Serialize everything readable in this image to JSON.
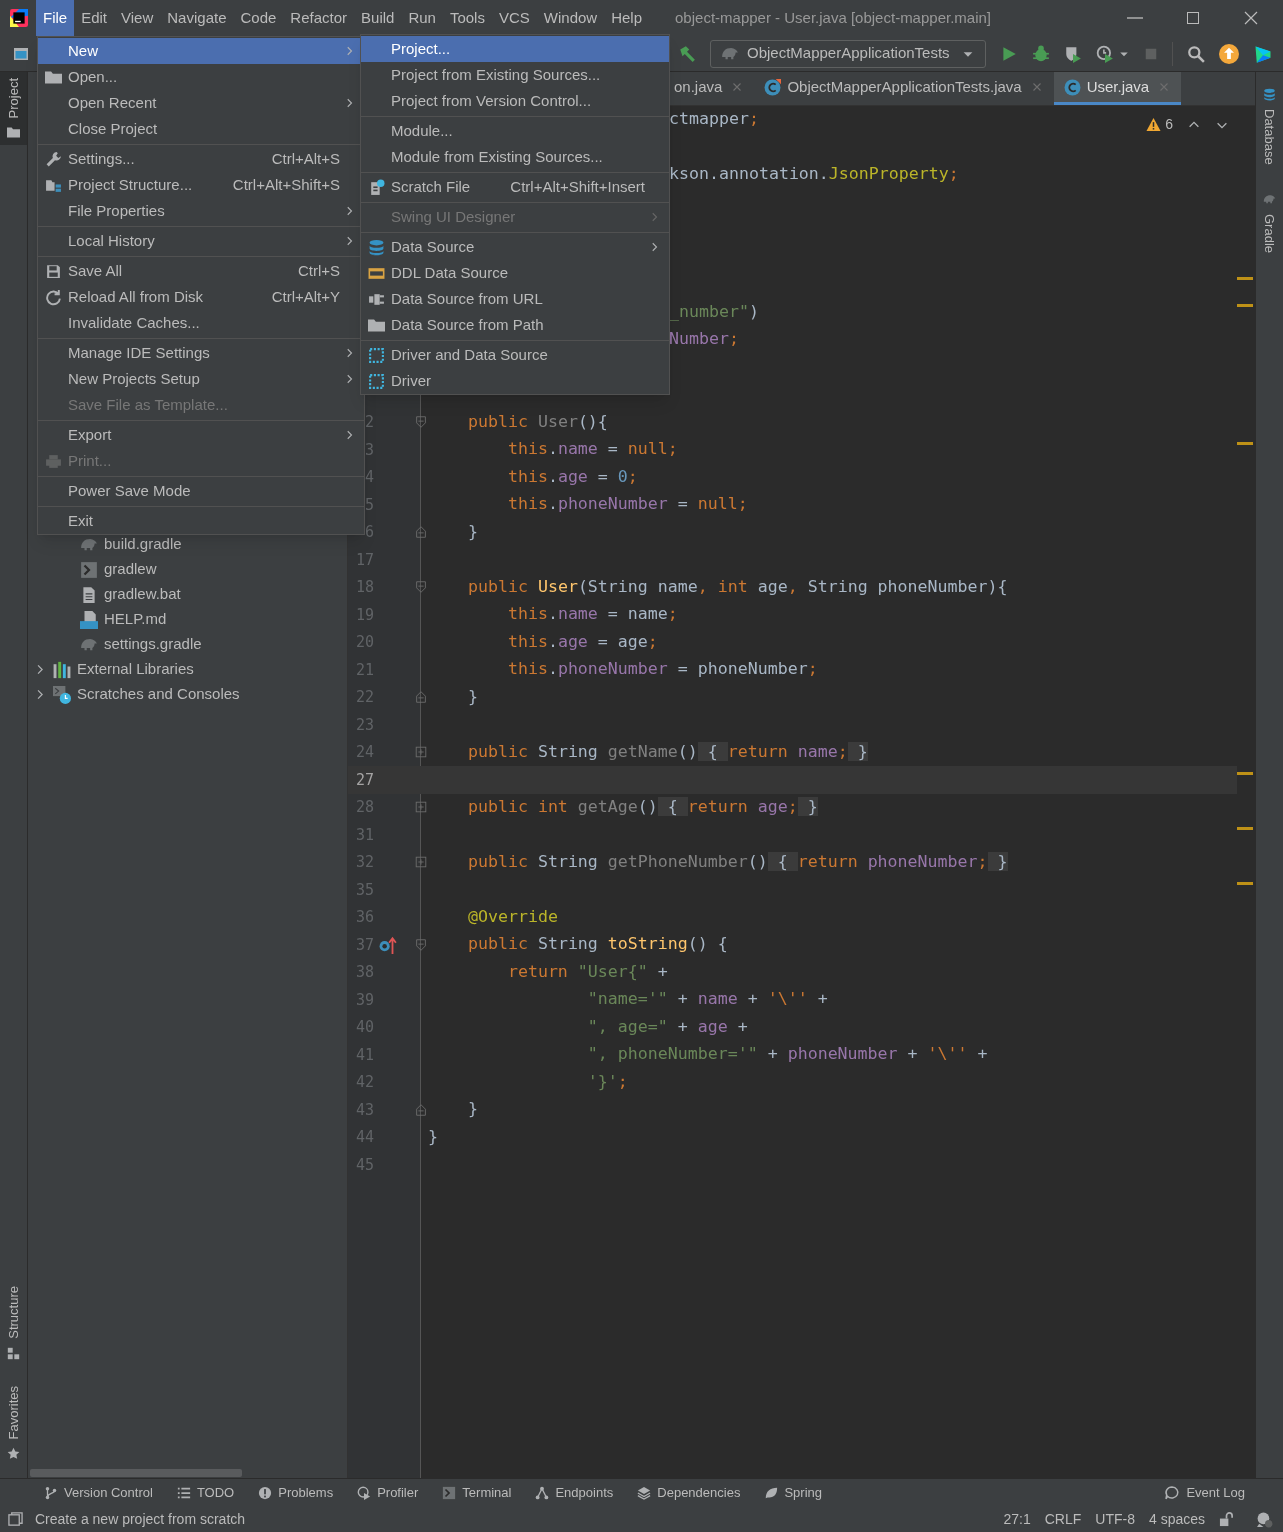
{
  "window": {
    "title": "object-mapper - User.java [object-mapper.main]"
  },
  "menubar": [
    {
      "label": "File",
      "selected": true
    },
    {
      "label": "Edit",
      "selected": false
    },
    {
      "label": "View",
      "selected": false
    },
    {
      "label": "Navigate",
      "selected": false
    },
    {
      "label": "Code",
      "selected": false
    },
    {
      "label": "Refactor",
      "selected": false
    },
    {
      "label": "Build",
      "selected": false
    },
    {
      "label": "Run",
      "selected": false
    },
    {
      "label": "Tools",
      "selected": false
    },
    {
      "label": "VCS",
      "selected": false
    },
    {
      "label": "Window",
      "selected": false
    },
    {
      "label": "Help",
      "selected": false
    }
  ],
  "file_menu": {
    "groups": [
      [
        {
          "label": "New",
          "submenu": true,
          "selected": true,
          "disabled": false
        },
        {
          "label": "Open...",
          "submenu": false,
          "selected": false,
          "disabled": false
        },
        {
          "label": "Open Recent",
          "submenu": true,
          "selected": false,
          "disabled": false
        },
        {
          "label": "Close Project",
          "submenu": false,
          "selected": false,
          "disabled": false
        }
      ],
      [
        {
          "label": "Settings...",
          "shortcut": "Ctrl+Alt+S",
          "submenu": false,
          "selected": false,
          "disabled": false
        },
        {
          "label": "Project Structure...",
          "shortcut": "Ctrl+Alt+Shift+S",
          "submenu": false,
          "selected": false,
          "disabled": false
        },
        {
          "label": "File Properties",
          "submenu": true,
          "selected": false,
          "disabled": false
        }
      ],
      [
        {
          "label": "Local History",
          "submenu": true,
          "selected": false,
          "disabled": false
        }
      ],
      [
        {
          "label": "Save All",
          "shortcut": "Ctrl+S",
          "submenu": false,
          "selected": false,
          "disabled": false
        },
        {
          "label": "Reload All from Disk",
          "shortcut": "Ctrl+Alt+Y",
          "submenu": false,
          "selected": false,
          "disabled": false
        },
        {
          "label": "Invalidate Caches...",
          "submenu": false,
          "selected": false,
          "disabled": false
        }
      ],
      [
        {
          "label": "Manage IDE Settings",
          "submenu": true,
          "selected": false,
          "disabled": false
        },
        {
          "label": "New Projects Setup",
          "submenu": true,
          "selected": false,
          "disabled": false
        },
        {
          "label": "Save File as Template...",
          "submenu": false,
          "selected": false,
          "disabled": true
        }
      ],
      [
        {
          "label": "Export",
          "submenu": true,
          "selected": false,
          "disabled": false
        },
        {
          "label": "Print...",
          "submenu": false,
          "selected": false,
          "disabled": true
        }
      ],
      [
        {
          "label": "Power Save Mode",
          "submenu": false,
          "selected": false,
          "disabled": false
        }
      ],
      [
        {
          "label": "Exit",
          "submenu": false,
          "selected": false,
          "disabled": false
        }
      ]
    ]
  },
  "new_submenu": {
    "groups": [
      [
        {
          "label": "Project...",
          "submenu": false,
          "selected": true,
          "disabled": false
        },
        {
          "label": "Project from Existing Sources...",
          "submenu": false,
          "selected": false,
          "disabled": false
        },
        {
          "label": "Project from Version Control...",
          "submenu": false,
          "selected": false,
          "disabled": false
        }
      ],
      [
        {
          "label": "Module...",
          "submenu": false,
          "selected": false,
          "disabled": false
        },
        {
          "label": "Module from Existing Sources...",
          "submenu": false,
          "selected": false,
          "disabled": false
        }
      ],
      [
        {
          "label": "Scratch File",
          "shortcut": "Ctrl+Alt+Shift+Insert",
          "submenu": false,
          "selected": false,
          "disabled": false
        }
      ],
      [
        {
          "label": "Swing UI Designer",
          "submenu": true,
          "selected": false,
          "disabled": true
        }
      ],
      [
        {
          "label": "Data Source",
          "submenu": true,
          "selected": false,
          "disabled": false
        },
        {
          "label": "DDL Data Source",
          "submenu": false,
          "selected": false,
          "disabled": false
        },
        {
          "label": "Data Source from URL",
          "submenu": false,
          "selected": false,
          "disabled": false
        },
        {
          "label": "Data Source from Path",
          "submenu": false,
          "selected": false,
          "disabled": false
        }
      ],
      [
        {
          "label": "Driver and Data Source",
          "submenu": false,
          "selected": false,
          "disabled": false
        },
        {
          "label": "Driver",
          "submenu": false,
          "selected": false,
          "disabled": false
        }
      ]
    ]
  },
  "toolbar": {
    "run_configuration": "ObjectMapperApplicationTests"
  },
  "tabs": [
    {
      "label": "on.java",
      "selected": false
    },
    {
      "label": "ObjectMapperApplicationTests.java",
      "selected": false
    },
    {
      "label": "User.java",
      "selected": true
    }
  ],
  "left_stripe": {
    "top": [
      {
        "label": "Project",
        "selected": true
      }
    ],
    "bottom": [
      {
        "label": "Structure",
        "selected": false
      },
      {
        "label": "Favorites",
        "selected": false
      }
    ]
  },
  "right_stripe": [
    {
      "label": "Database",
      "selected": false
    },
    {
      "label": "Gradle",
      "selected": false
    }
  ],
  "project_tree": {
    "files": [
      {
        "label": "build.gradle"
      },
      {
        "label": "gradlew"
      },
      {
        "label": "gradlew.bat"
      },
      {
        "label": "HELP.md"
      },
      {
        "label": "settings.gradle"
      }
    ],
    "nodes": [
      {
        "label": "External Libraries",
        "expanded": false
      },
      {
        "label": "Scratches and Consoles",
        "expanded": false
      }
    ]
  },
  "editor": {
    "warnings": "6",
    "lines": [
      {
        "kind": "clipped",
        "tokens": [
          {
            "kind": "plain",
            "text": "ctmapper"
          },
          {
            "kind": "kw",
            "text": ";"
          }
        ]
      },
      {
        "kind": "blank"
      },
      {
        "kind": "clipped",
        "tokens": [
          {
            "kind": "plain",
            "text": "kson.annotation."
          },
          {
            "kind": "ann",
            "text": "JsonProperty"
          },
          {
            "kind": "kw",
            "text": ";"
          }
        ]
      },
      {
        "kind": "blank"
      },
      {
        "kind": "blank"
      },
      {
        "kind": "blank"
      },
      {
        "kind": "blank"
      },
      {
        "kind": "clipped",
        "tokens": [
          {
            "kind": "str",
            "text": "_number\""
          },
          {
            "kind": "plain",
            "text": ")"
          }
        ]
      },
      {
        "kind": "clipped",
        "tokens": [
          {
            "kind": "field",
            "text": "Number"
          },
          {
            "kind": "kw",
            "text": ";"
          }
        ]
      },
      {
        "kind": "blank"
      },
      {
        "kind": "blank"
      },
      {
        "kind": "code",
        "number": "2",
        "gutter": [
          {
            "kind": "fold_open"
          }
        ],
        "tokens": [
          {
            "kind": "kw",
            "text": "    public "
          },
          {
            "kind": "muted",
            "text": "User"
          },
          {
            "kind": "plain",
            "text": "(){"
          }
        ]
      },
      {
        "kind": "code",
        "number": "3",
        "tokens": [
          {
            "kind": "kw",
            "text": "        this"
          },
          {
            "kind": "plain",
            "text": "."
          },
          {
            "kind": "field",
            "text": "name"
          },
          {
            "kind": "plain",
            "text": " = "
          },
          {
            "kind": "kw",
            "text": "null;"
          }
        ]
      },
      {
        "kind": "code",
        "number": "4",
        "tokens": [
          {
            "kind": "kw",
            "text": "        this"
          },
          {
            "kind": "plain",
            "text": "."
          },
          {
            "kind": "field",
            "text": "age"
          },
          {
            "kind": "plain",
            "text": " = "
          },
          {
            "kind": "num",
            "text": "0"
          },
          {
            "kind": "kw",
            "text": ";"
          }
        ]
      },
      {
        "kind": "code",
        "number": "5",
        "tokens": [
          {
            "kind": "kw",
            "text": "        this"
          },
          {
            "kind": "plain",
            "text": "."
          },
          {
            "kind": "field",
            "text": "phoneNumber"
          },
          {
            "kind": "plain",
            "text": " = "
          },
          {
            "kind": "kw",
            "text": "null;"
          }
        ]
      },
      {
        "kind": "code",
        "number": "6",
        "gutter": [
          {
            "kind": "fold_close"
          }
        ],
        "tokens": [
          {
            "kind": "plain",
            "text": "    }"
          }
        ]
      },
      {
        "number": "17"
      },
      {
        "kind": "code",
        "number": "18",
        "gutter": [
          {
            "kind": "fold_open"
          }
        ],
        "tokens": [
          {
            "kind": "kw",
            "text": "    public "
          },
          {
            "kind": "decl",
            "text": "User"
          },
          {
            "kind": "plain",
            "text": "(String name"
          },
          {
            "kind": "kw",
            "text": ", int "
          },
          {
            "kind": "plain",
            "text": "age"
          },
          {
            "kind": "kw",
            "text": ", "
          },
          {
            "kind": "plain",
            "text": "String phoneNumber){"
          }
        ]
      },
      {
        "kind": "code",
        "number": "19",
        "tokens": [
          {
            "kind": "kw",
            "text": "        this"
          },
          {
            "kind": "plain",
            "text": "."
          },
          {
            "kind": "field",
            "text": "name"
          },
          {
            "kind": "plain",
            "text": " = name"
          },
          {
            "kind": "kw",
            "text": ";"
          }
        ]
      },
      {
        "kind": "code",
        "number": "20",
        "tokens": [
          {
            "kind": "kw",
            "text": "        this"
          },
          {
            "kind": "plain",
            "text": "."
          },
          {
            "kind": "field",
            "text": "age"
          },
          {
            "kind": "plain",
            "text": " = age"
          },
          {
            "kind": "kw",
            "text": ";"
          }
        ]
      },
      {
        "kind": "code",
        "number": "21",
        "tokens": [
          {
            "kind": "kw",
            "text": "        this"
          },
          {
            "kind": "plain",
            "text": "."
          },
          {
            "kind": "field",
            "text": "phoneNumber"
          },
          {
            "kind": "plain",
            "text": " = phoneNumber"
          },
          {
            "kind": "kw",
            "text": ";"
          }
        ]
      },
      {
        "kind": "code",
        "number": "22",
        "gutter": [
          {
            "kind": "fold_close"
          }
        ],
        "tokens": [
          {
            "kind": "plain",
            "text": "    }"
          }
        ]
      },
      {
        "number": "23"
      },
      {
        "kind": "code",
        "number": "24",
        "gutter": [
          {
            "kind": "folded"
          }
        ],
        "tokens": [
          {
            "kind": "kw",
            "text": "    public "
          },
          {
            "kind": "plain",
            "text": "String "
          },
          {
            "kind": "muted",
            "text": "getName"
          },
          {
            "kind": "plain",
            "text": "()"
          },
          {
            "kind": "fold",
            "text": " { "
          },
          {
            "kind": "kw",
            "text": "return "
          },
          {
            "kind": "field",
            "text": "name"
          },
          {
            "kind": "kw",
            "text": ";"
          },
          {
            "kind": "fold",
            "text": " }"
          }
        ]
      },
      {
        "number": "27",
        "current": true
      },
      {
        "kind": "code",
        "number": "28",
        "gutter": [
          {
            "kind": "folded"
          }
        ],
        "tokens": [
          {
            "kind": "kw",
            "text": "    public int "
          },
          {
            "kind": "muted",
            "text": "getAge"
          },
          {
            "kind": "plain",
            "text": "()"
          },
          {
            "kind": "fold",
            "text": " { "
          },
          {
            "kind": "kw",
            "text": "return "
          },
          {
            "kind": "field",
            "text": "age"
          },
          {
            "kind": "kw",
            "text": ";"
          },
          {
            "kind": "fold",
            "text": " }"
          }
        ]
      },
      {
        "number": "31"
      },
      {
        "kind": "code",
        "number": "32",
        "gutter": [
          {
            "kind": "folded"
          }
        ],
        "tokens": [
          {
            "kind": "kw",
            "text": "    public "
          },
          {
            "kind": "plain",
            "text": "String "
          },
          {
            "kind": "muted",
            "text": "getPhoneNumber"
          },
          {
            "kind": "plain",
            "text": "()"
          },
          {
            "kind": "fold",
            "text": " { "
          },
          {
            "kind": "kw",
            "text": "return "
          },
          {
            "kind": "field",
            "text": "phoneNumber"
          },
          {
            "kind": "kw",
            "text": ";"
          },
          {
            "kind": "fold",
            "text": " }"
          }
        ]
      },
      {
        "number": "35"
      },
      {
        "kind": "code",
        "number": "36",
        "tokens": [
          {
            "kind": "ann",
            "text": "    @Override"
          }
        ]
      },
      {
        "kind": "code",
        "number": "37",
        "gutter": [
          {
            "kind": "override"
          },
          {
            "kind": "fold_open"
          }
        ],
        "tokens": [
          {
            "kind": "kw",
            "text": "    public "
          },
          {
            "kind": "plain",
            "text": "String "
          },
          {
            "kind": "decl",
            "text": "toString"
          },
          {
            "kind": "plain",
            "text": "() {"
          }
        ]
      },
      {
        "kind": "code",
        "number": "38",
        "tokens": [
          {
            "kind": "kw",
            "text": "        return "
          },
          {
            "kind": "str",
            "text": "\"User{\""
          },
          {
            "kind": "plain",
            "text": " +"
          }
        ]
      },
      {
        "kind": "code",
        "number": "39",
        "tokens": [
          {
            "kind": "str",
            "text": "                \"name='\""
          },
          {
            "kind": "plain",
            "text": " + "
          },
          {
            "kind": "field",
            "text": "name"
          },
          {
            "kind": "plain",
            "text": " + "
          },
          {
            "kind": "kw",
            "text": "'\\''"
          },
          {
            "kind": "plain",
            "text": " +"
          }
        ]
      },
      {
        "kind": "code",
        "number": "40",
        "tokens": [
          {
            "kind": "str",
            "text": "                \", age=\""
          },
          {
            "kind": "plain",
            "text": " + "
          },
          {
            "kind": "field",
            "text": "age"
          },
          {
            "kind": "plain",
            "text": " +"
          }
        ]
      },
      {
        "kind": "code",
        "number": "41",
        "tokens": [
          {
            "kind": "str",
            "text": "                \", phoneNumber='\""
          },
          {
            "kind": "plain",
            "text": " + "
          },
          {
            "kind": "field",
            "text": "phoneNumber"
          },
          {
            "kind": "plain",
            "text": " + "
          },
          {
            "kind": "kw",
            "text": "'\\''"
          },
          {
            "kind": "plain",
            "text": " +"
          }
        ]
      },
      {
        "kind": "code",
        "number": "42",
        "tokens": [
          {
            "kind": "str",
            "text": "                '}'"
          },
          {
            "kind": "kw",
            "text": ";"
          }
        ]
      },
      {
        "kind": "code",
        "number": "43",
        "gutter": [
          {
            "kind": "fold_close"
          }
        ],
        "tokens": [
          {
            "kind": "plain",
            "text": "    }"
          }
        ]
      },
      {
        "kind": "code",
        "number": "44",
        "tokens": [
          {
            "kind": "plain",
            "text": "}"
          }
        ]
      },
      {
        "number": "45"
      }
    ]
  },
  "tool_windows": [
    "Version Control",
    "TODO",
    "Problems",
    "Profiler",
    "Terminal",
    "Endpoints",
    "Dependencies",
    "Spring"
  ],
  "event_log": "Event Log",
  "status_bar": {
    "message": "Create a new project from scratch",
    "position": "27:1",
    "line_separator": "CRLF",
    "encoding": "UTF-8",
    "indent": "4 spaces"
  }
}
